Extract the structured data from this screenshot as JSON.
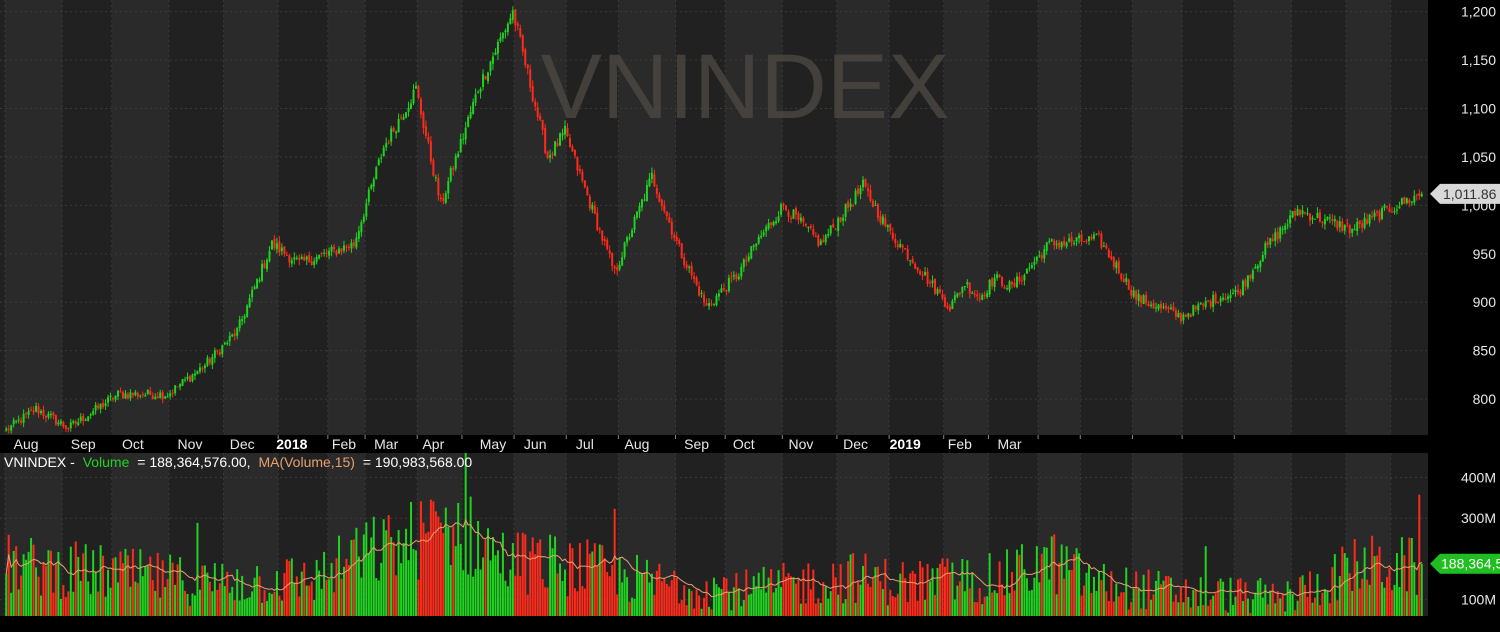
{
  "colors": {
    "background": "#000000",
    "panel": "#212121",
    "band": "#2a2a2a",
    "grid": "#3a3a3a",
    "up": "#1fd41f",
    "down": "#ff2a1a",
    "ma": "#e8a070",
    "watermark": "#4a4640"
  },
  "chart_data": [
    {
      "type": "candlestick",
      "watermark": "VNINDEX",
      "ylim": [
        765,
        1210
      ],
      "y_ticks": [
        "1,200",
        "1,150",
        "1,100",
        "1,050",
        "1,000",
        "950",
        "900",
        "850",
        "800"
      ],
      "y_tick_values": [
        1200,
        1150,
        1100,
        1050,
        1000,
        950,
        900,
        850,
        800
      ],
      "last_value_label": "1,011.86",
      "last_value": 1011.86,
      "x_labels": [
        "Aug",
        "Sep",
        "Oct",
        "Nov",
        "Dec",
        "2018",
        "Feb",
        "Mar",
        "Apr",
        "May",
        "Jun",
        "Jul",
        "Aug",
        "Sep",
        "Oct",
        "Nov",
        "Dec",
        "2019",
        "Feb",
        "Mar"
      ],
      "x_label_is_year": [
        false,
        false,
        false,
        false,
        false,
        true,
        false,
        false,
        false,
        false,
        false,
        false,
        false,
        false,
        false,
        false,
        false,
        true,
        false,
        false
      ],
      "series_anchors": {
        "trading_day_index": [
          0,
          12,
          25,
          45,
          65,
          80,
          93,
          107,
          118,
          140,
          152,
          165,
          175,
          190,
          204,
          218,
          225,
          245,
          260,
          271,
          282,
          295,
          303,
          313,
          328,
          345,
          355,
          380,
          386,
          392,
          398,
          405,
          420,
          440,
          455,
          473,
          488,
          496,
          507,
          520,
          542,
          556,
          570
        ],
        "close": [
          768,
          790,
          770,
          805,
          805,
          835,
          870,
          960,
          940,
          960,
          1060,
          1120,
          1000,
          1120,
          1200,
          1050,
          1075,
          930,
          1030,
          955,
          895,
          930,
          965,
          1000,
          960,
          1020,
          975,
          895,
          920,
          905,
          925,
          915,
          960,
          965,
          905,
          885,
          905,
          910,
          955,
          995,
          975,
          995,
          1011.86
        ]
      }
    },
    {
      "type": "bar",
      "legend_prefix": "VNINDEX -",
      "legend_volume": "Volume = 188,364,576.00,",
      "legend_ma": "MA(Volume,15) = 190,983,568.00",
      "ylim": [
        60,
        460
      ],
      "y_ticks": [
        "400M",
        "300M",
        "100M"
      ],
      "y_tick_values": [
        400,
        300,
        100
      ],
      "last_value_label": "188,364,5",
      "last_value": 188.364576,
      "value_unit": "M",
      "baseline_anchors": {
        "trading_day_index": [
          0,
          40,
          80,
          125,
          140,
          160,
          180,
          200,
          230,
          260,
          280,
          300,
          340,
          360,
          400,
          420,
          440,
          470,
          490,
          515,
          530,
          545,
          570
        ],
        "volume": [
          195,
          175,
          150,
          160,
          215,
          250,
          300,
          210,
          190,
          150,
          140,
          130,
          165,
          150,
          160,
          205,
          145,
          125,
          120,
          110,
          150,
          195,
          188
        ]
      }
    }
  ]
}
